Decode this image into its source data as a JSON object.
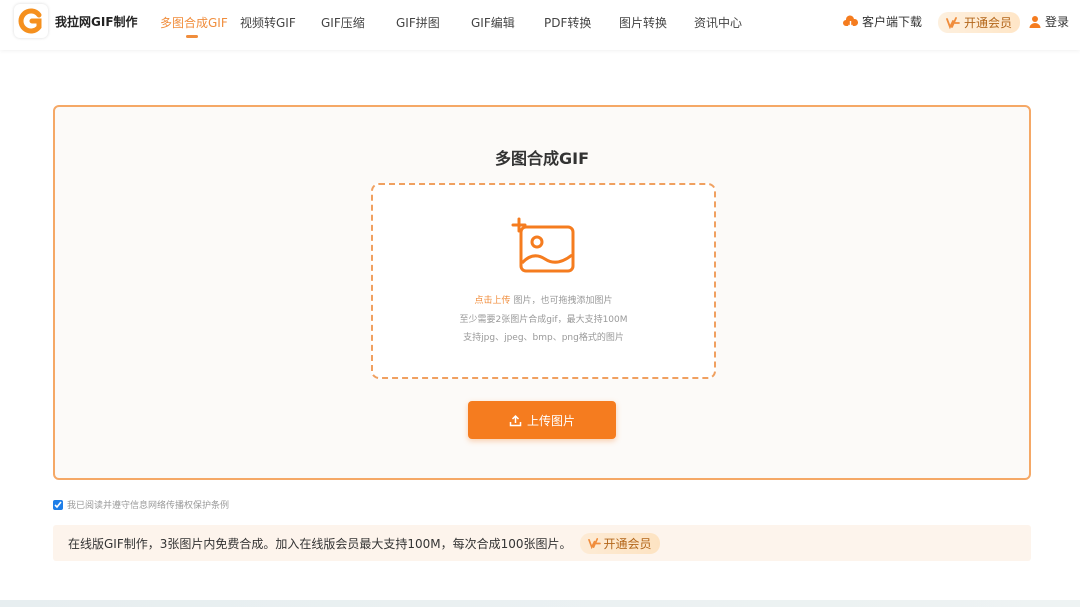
{
  "header": {
    "site_name": "我拉网GIF制作",
    "nav": [
      {
        "label": "多图合成GIF",
        "active": true
      },
      {
        "label": "视频转GIF",
        "active": false
      },
      {
        "label": "GIF压缩",
        "active": false
      },
      {
        "label": "GIF拼图",
        "active": false
      },
      {
        "label": "GIF编辑",
        "active": false
      },
      {
        "label": "PDF转换",
        "active": false
      },
      {
        "label": "图片转换",
        "active": false
      },
      {
        "label": "资讯中心",
        "active": false
      }
    ],
    "download_label": "客户端下载",
    "vip_label": "开通会员",
    "login_label": "登录"
  },
  "upload": {
    "title": "多图合成GIF",
    "click_text": "点击上传",
    "hint_suffix": "图片，也可拖拽添加图片",
    "hint_line2": "至少需要2张图片合成gif，最大支持100M",
    "hint_line3": "支持jpg、jpeg、bmp、png格式的图片",
    "button_label": "上传图片"
  },
  "agreement": {
    "checked": true,
    "label": "我已阅读并遵守信息网络传播权保护条例"
  },
  "info_bar": {
    "text": "在线版GIF制作，3张图片内免费合成。加入在线版会员最大支持100M，每次合成100张图片。",
    "vip_label": "开通会员"
  },
  "colors": {
    "accent": "#f08d3c",
    "button": "#f57c1f",
    "card_border": "#f5a866"
  }
}
